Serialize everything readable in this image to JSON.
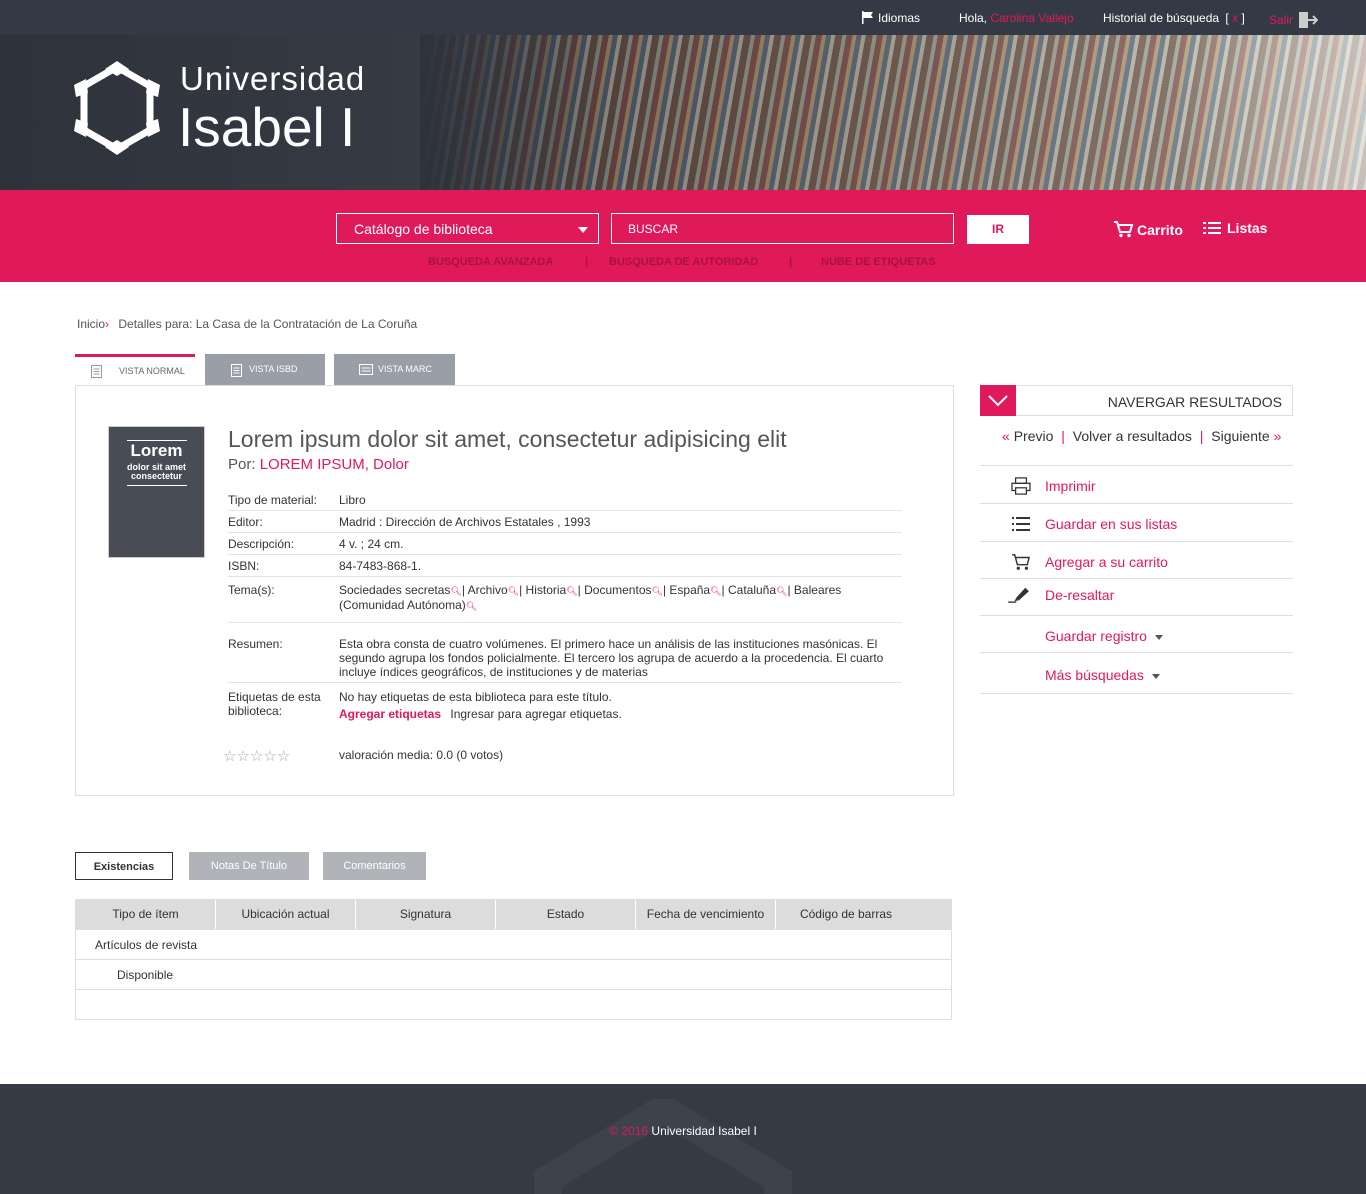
{
  "topbar": {
    "languages": "Idiomas",
    "greeting": "Hola,",
    "user": "Carolina Vallejo",
    "history": "Historial de búsqueda",
    "history_open": "[",
    "history_clear": "x",
    "history_close": "]",
    "logout": "Salir"
  },
  "brand": {
    "line1": "Universidad",
    "line2": "Isabel I"
  },
  "search": {
    "catalog": "Catálogo de biblioteca",
    "placeholder": "BUSCAR",
    "go": "IR",
    "cart": "Carrito",
    "lists": "Listas",
    "advanced": "BUSQUEDA AVANZADA",
    "authority": "BUSQUEDA DE AUTORIDAD",
    "tags": "NUBE DE ETIQUETAS",
    "separator": "|"
  },
  "breadcrumb": {
    "home": "Inicio",
    "arrow": "›",
    "current": "Detalles para: La Casa de la Contratación de La Coruña"
  },
  "tabs": {
    "normal": "VISTA NORMAL",
    "isbd": "VISTA ISBD",
    "marc": "VISTA MARC"
  },
  "record": {
    "cover_line1": "Lorem",
    "cover_line2": "dolor sit amet",
    "cover_line3": "consectetur",
    "title": "Lorem ipsum dolor sit amet, consectetur adipisicing elit",
    "by": "Por:",
    "author": "LOREM IPSUM, Dolor",
    "material_label": "Tipo de material:",
    "material": "Libro",
    "publisher_label": "Editor:",
    "publisher": "Madrid : Dirección de Archivos Estatales , 1993",
    "description_label": "Descripción:",
    "description": "4 v. ; 24 cm.",
    "isbn_label": "ISBN:",
    "isbn": "84-7483-868-1.",
    "subjects_label": "Tema(s):",
    "subjects": [
      "Sociedades secretas",
      "Archivo",
      "Historia",
      "Documentos",
      "España",
      "Cataluña",
      "Baleares (Comunidad Autónoma)"
    ],
    "summary_label": "Resumen:",
    "summary": "Esta obra consta de cuatro volúmenes. El primero hace un análisis de las instituciones masónicas. El segundo agrupa los fondos policialmente. El tercero los agrupa de acuerdo a la procedencia. El cuarto incluye índices geográficos, de instituciones y de materias",
    "tags_label": "Etiquetas de esta biblioteca:",
    "tags_none": "No hay etiquetas de esta biblioteca para este título.",
    "tags_add": "Agregar etiquetas",
    "tags_login": "Ingresar para agregar etiquetas.",
    "rating": 0,
    "rating_max": 5,
    "rating_text": "valoración media: 0.0 (0 votos)"
  },
  "sidebar": {
    "nav_title": "NAVERGAR RESULTADOS",
    "prev_mark": "«",
    "prev": "Previo",
    "back": "Volver a resultados",
    "next": "Siguiente",
    "next_mark": "»",
    "sep": "|",
    "print": "Imprimir",
    "save_lists": "Guardar en sus listas",
    "add_cart": "Agregar a su carrito",
    "unhighlight": "De-resaltar",
    "save_record": "Guardar registro",
    "more_searches": "Más búsquedas"
  },
  "bottom_tabs": {
    "holdings": "Existencias",
    "notes": "Notas De Título",
    "comments": "Comentarios"
  },
  "holdings": {
    "columns": [
      "Tipo de ítem",
      "Ubicación actual",
      "Signatura",
      "Estado",
      "Fecha de vencimiento",
      "Código de barras"
    ],
    "row1": "Artículos de revista",
    "row2": "Disponible"
  },
  "footer": {
    "year": "© 2016",
    "org": "Universidad Isabel I"
  },
  "colors": {
    "accent": "#e0195b",
    "dark": "#343a45"
  }
}
